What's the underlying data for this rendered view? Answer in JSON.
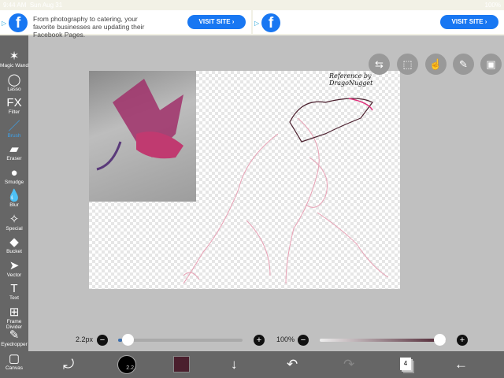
{
  "status": {
    "time": "9:44 AM",
    "date": "Sun Aug 31",
    "battery": "100%"
  },
  "ads": [
    {
      "text": "From photography to catering, your favorite businesses are updating their Facebook Pages.",
      "button": "VISIT SITE ›",
      "logo": "f"
    },
    {
      "text": "",
      "button": "VISIT SITE ›",
      "logo": "f"
    }
  ],
  "tools": [
    {
      "label": "Magic Wand",
      "icon": "magic-wand-icon",
      "glyph": "✶"
    },
    {
      "label": "Lasso",
      "icon": "lasso-icon",
      "glyph": "◯"
    },
    {
      "label": "Filter",
      "icon": "fx-icon",
      "glyph": "FX"
    },
    {
      "label": "Brush",
      "icon": "brush-icon",
      "glyph": "／"
    },
    {
      "label": "Eraser",
      "icon": "eraser-icon",
      "glyph": "▰"
    },
    {
      "label": "Smudge",
      "icon": "smudge-icon",
      "glyph": "●"
    },
    {
      "label": "Blur",
      "icon": "blur-icon",
      "glyph": "💧"
    },
    {
      "label": "Special",
      "icon": "special-icon",
      "glyph": "✧"
    },
    {
      "label": "Bucket",
      "icon": "bucket-icon",
      "glyph": "◆"
    },
    {
      "label": "Vector",
      "icon": "vector-icon",
      "glyph": "➤"
    },
    {
      "label": "Text",
      "icon": "text-icon",
      "glyph": "T"
    },
    {
      "label": "Frame Divider",
      "icon": "frame-divider-icon",
      "glyph": "⊞"
    },
    {
      "label": "Eyedropper",
      "icon": "eyedropper-icon",
      "glyph": "✎"
    },
    {
      "label": "Canvas",
      "icon": "canvas-icon",
      "glyph": "▢"
    }
  ],
  "active_tool": "Brush",
  "canvas_text": "Reference by DragoNugget",
  "brush": {
    "size_label": "2.2px",
    "size_fraction": 0.03,
    "opacity_label": "100%",
    "opacity_fraction": 1.0,
    "indicator": "2.2"
  },
  "layers_count": "4",
  "colors": {
    "current": "#4a1f2d",
    "accent": "#3fa2ea"
  }
}
